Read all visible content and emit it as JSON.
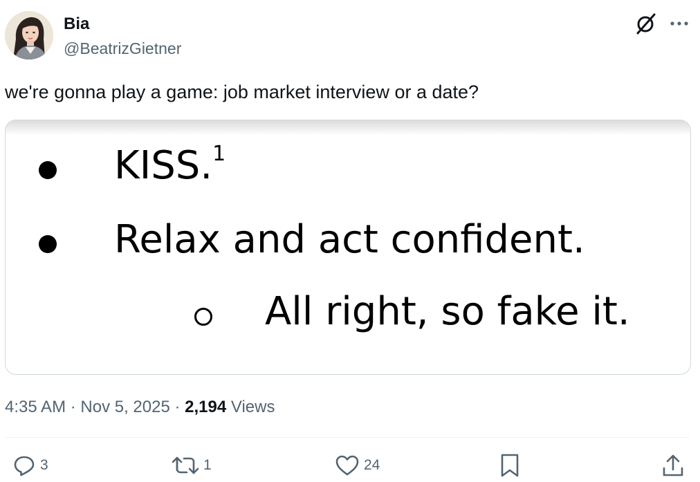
{
  "author": {
    "display_name": "Bia",
    "handle": "@BeatrizGietner",
    "avatar_icon": "avatar-portrait"
  },
  "header_icons": {
    "grok": "grok-icon",
    "more": "more-icon"
  },
  "tweet": {
    "text": "we're gonna play a game: job market interview or a date?",
    "media": {
      "line1_text": "KISS.",
      "line1_superscript": "1",
      "line2_text": "Relax and act confident.",
      "line3_text": "All right, so fake it."
    }
  },
  "meta": {
    "time": "4:35 AM",
    "separator": " · ",
    "date": "Nov 5, 2025",
    "views_count": "2,194",
    "views_label": " Views"
  },
  "actions": {
    "replies": "3",
    "reposts": "1",
    "likes": "24",
    "bookmark_icon": "bookmark-icon",
    "share_icon": "share-icon"
  },
  "colors": {
    "text_primary": "#0f1419",
    "text_secondary": "#536471",
    "border": "#cfd9de"
  }
}
